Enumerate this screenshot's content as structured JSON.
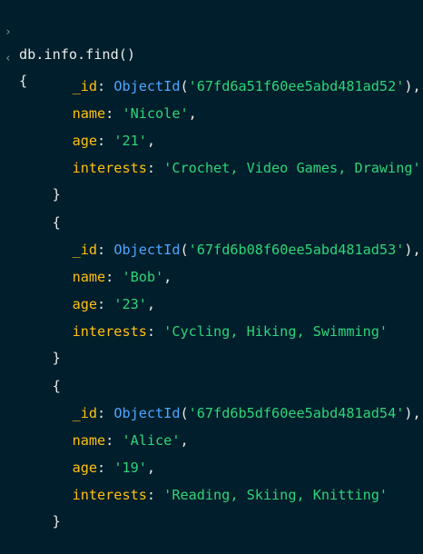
{
  "command": {
    "chevron": "›",
    "text": "db.info.find()"
  },
  "output": {
    "chevron": "‹",
    "open_brace": "{",
    "close_brace": "}",
    "documents": [
      {
        "id_key": "_id",
        "id_fn": "ObjectId",
        "id_value": "'67fd6a51f60ee5abd481ad52'",
        "name_key": "name",
        "name_value": "'Nicole'",
        "age_key": "age",
        "age_value": "'21'",
        "interests_key": "interests",
        "interests_value": "'Crochet, Video Games, Drawing'"
      },
      {
        "id_key": "_id",
        "id_fn": "ObjectId",
        "id_value": "'67fd6b08f60ee5abd481ad53'",
        "name_key": "name",
        "name_value": "'Bob'",
        "age_key": "age",
        "age_value": "'23'",
        "interests_key": "interests",
        "interests_value": "'Cycling, Hiking, Swimming'"
      },
      {
        "id_key": "_id",
        "id_fn": "ObjectId",
        "id_value": "'67fd6b5df60ee5abd481ad54'",
        "name_key": "name",
        "name_value": "'Alice'",
        "age_key": "age",
        "age_value": "'19'",
        "interests_key": "interests",
        "interests_value": "'Reading, Skiing, Knitting'"
      }
    ]
  },
  "colors": {
    "background": "#001e2b",
    "key": "#ffc010",
    "function": "#4ea6ff",
    "string": "#2ed47a",
    "text": "#e8edeb"
  }
}
